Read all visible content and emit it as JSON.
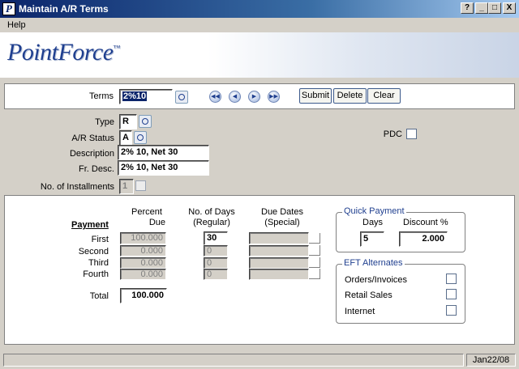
{
  "window": {
    "title": "Maintain A/R Terms",
    "app_icon": "P",
    "help_btn": "?",
    "minimize_btn": "_",
    "maximize_btn": "□",
    "close_btn": "X"
  },
  "menu": {
    "help": "Help"
  },
  "banner": {
    "logo_main": "PointForce",
    "logo_mark": "™"
  },
  "toolbar": {
    "terms_label": "Terms",
    "terms_value": "2%10",
    "nav_first": "◀◀",
    "nav_prev": "◀",
    "nav_next": "▶",
    "nav_last": "▶▶",
    "submit": "Submit",
    "delete": "Delete",
    "clear": "Clear"
  },
  "details": {
    "type_label": "Type",
    "type_value": "R",
    "ar_status_label": "A/R Status",
    "ar_status_value": "A",
    "description_label": "Description",
    "description_value": "2% 10, Net 30",
    "fr_desc_label": "Fr. Desc.",
    "fr_desc_value": "2% 10, Net 30",
    "installments_label": "No. of Installments",
    "installments_value": "1",
    "pdc_label": "PDC",
    "pdc_checked": false
  },
  "payments": {
    "header_payment": "Payment",
    "header_percent_1": "Percent",
    "header_percent_2": "Due",
    "header_days_1": "No. of Days",
    "header_days_2": "(Regular)",
    "header_dates_1": "Due Dates",
    "header_dates_2": "(Special)",
    "rows": [
      {
        "label": "First",
        "percent": "100.000",
        "days": "30",
        "date": ""
      },
      {
        "label": "Second",
        "percent": "0.000",
        "days": "0",
        "date": ""
      },
      {
        "label": "Third",
        "percent": "0.000",
        "days": "0",
        "date": ""
      },
      {
        "label": "Fourth",
        "percent": "0.000",
        "days": "0",
        "date": ""
      }
    ],
    "total_label": "Total",
    "total_value": "100.000"
  },
  "quick_payment": {
    "legend": "Quick Payment",
    "days_label": "Days",
    "discount_label": "Discount %",
    "days_value": "5",
    "discount_value": "2.000"
  },
  "eft": {
    "legend": "EFT Alternates",
    "orders_invoices": "Orders/Invoices",
    "retail_sales": "Retail Sales",
    "internet": "Internet"
  },
  "status": {
    "date": "Jan22/08"
  }
}
